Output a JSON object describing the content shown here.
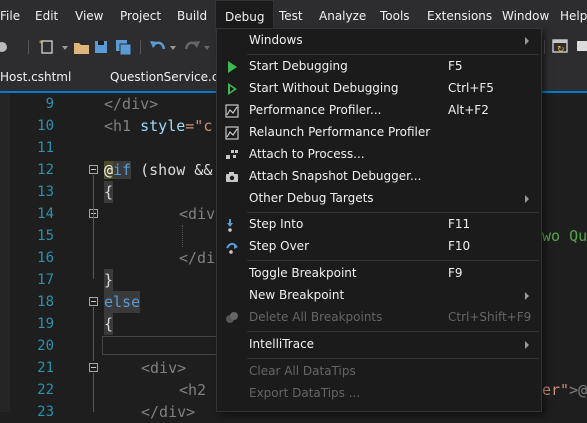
{
  "menubar": {
    "items": [
      {
        "label": "File"
      },
      {
        "label": "Edit"
      },
      {
        "label": "View"
      },
      {
        "label": "Project"
      },
      {
        "label": "Build"
      },
      {
        "label": "Debug"
      },
      {
        "label": "Test"
      },
      {
        "label": "Analyze"
      },
      {
        "label": "Tools"
      },
      {
        "label": "Extensions"
      },
      {
        "label": "Window"
      },
      {
        "label": "Help"
      }
    ]
  },
  "tabs": [
    {
      "label": "Host.cshtml"
    },
    {
      "label": "QuestionService.cs"
    }
  ],
  "editor": {
    "line_numbers": [
      "9",
      "10",
      "11",
      "12",
      "13",
      "14",
      "15",
      "16",
      "17",
      "18",
      "19",
      "20",
      "21",
      "22",
      "23"
    ],
    "lines": {
      "l9": "</div>",
      "l10_a": "<h1 ",
      "l10_b": "style",
      "l10_c": "=\"c",
      "l12_at": "@",
      "l12_if": "if",
      "l12_rest": " (show &&",
      "l13": "{",
      "l14": "<div",
      "l16": "</di",
      "l17": "}",
      "l18": "else",
      "l19": "{",
      "l21": "<div>",
      "l22": "<h2",
      "l23": "</div>"
    },
    "right_fragments": {
      "r14": "wo Qu",
      "r22_str": "er\"",
      "r22_rest": ">@"
    }
  },
  "debug_menu": {
    "items": [
      {
        "label": "Windows",
        "shortcut": "",
        "submenu": true,
        "enabled": true,
        "icon": "none"
      },
      {
        "label": "Start Debugging",
        "shortcut": "F5",
        "submenu": false,
        "enabled": true,
        "icon": "play-icon"
      },
      {
        "label": "Start Without Debugging",
        "shortcut": "Ctrl+F5",
        "submenu": false,
        "enabled": true,
        "icon": "play-outline-icon"
      },
      {
        "label": "Performance Profiler...",
        "shortcut": "Alt+F2",
        "submenu": false,
        "enabled": true,
        "icon": "profiler-icon"
      },
      {
        "label": "Relaunch Performance Profiler",
        "shortcut": "",
        "submenu": false,
        "enabled": true,
        "icon": "profiler-icon"
      },
      {
        "label": "Attach to Process...",
        "shortcut": "",
        "submenu": false,
        "enabled": true,
        "icon": "attach-icon"
      },
      {
        "label": "Attach Snapshot Debugger...",
        "shortcut": "",
        "submenu": false,
        "enabled": true,
        "icon": "camera-icon"
      },
      {
        "label": "Other Debug Targets",
        "shortcut": "",
        "submenu": true,
        "enabled": true,
        "icon": "none"
      },
      {
        "label": "Step Into",
        "shortcut": "F11",
        "submenu": false,
        "enabled": true,
        "icon": "step-into-icon"
      },
      {
        "label": "Step Over",
        "shortcut": "F10",
        "submenu": false,
        "enabled": true,
        "icon": "step-over-icon"
      },
      {
        "label": "Toggle Breakpoint",
        "shortcut": "F9",
        "submenu": false,
        "enabled": true,
        "icon": "none"
      },
      {
        "label": "New Breakpoint",
        "shortcut": "",
        "submenu": true,
        "enabled": true,
        "icon": "none"
      },
      {
        "label": "Delete All Breakpoints",
        "shortcut": "Ctrl+Shift+F9",
        "submenu": false,
        "enabled": false,
        "icon": "breakpoints-icon"
      },
      {
        "label": "IntelliTrace",
        "shortcut": "",
        "submenu": true,
        "enabled": true,
        "icon": "none"
      },
      {
        "label": "Clear All DataTips",
        "shortcut": "",
        "submenu": false,
        "enabled": false,
        "icon": "none"
      },
      {
        "label": "Export DataTips ...",
        "shortcut": "",
        "submenu": false,
        "enabled": false,
        "icon": "none"
      }
    ]
  },
  "colors": {
    "accent": "#007acc",
    "menu_bg": "#1b1b1c",
    "chrome_bg": "#2d2d30",
    "play_green": "#3fb950"
  }
}
